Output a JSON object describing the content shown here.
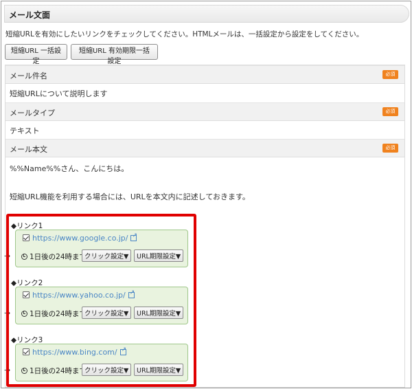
{
  "section": {
    "title": "メール文面",
    "description": "短縮URLを有効にしたいリンクをチェックしてください。HTMLメールは、一括設定から設定をしてください。"
  },
  "buttons": {
    "bulk_short_url": "短縮URL 一括設定",
    "bulk_expiry": "短縮URL 有効期限一括設定"
  },
  "required_label": "必須",
  "fields": {
    "subject": {
      "label": "メール件名",
      "value": "短縮URLについて説明します"
    },
    "type": {
      "label": "メールタイプ",
      "value": "テキスト"
    },
    "body": {
      "label": "メール本文",
      "line1": "%%Name%%さん、こんにちは。",
      "line2": "短縮URL機能を利用する場合には、URLを本文内に記述しておきます。"
    }
  },
  "arrow": "→",
  "links": [
    {
      "label": "◆リンク1",
      "url": "https://www.google.co.jp/",
      "expiry": "1日後の24時まで",
      "click_setting": "クリック設定▼",
      "url_expiry": "URL期限設定▼"
    },
    {
      "label": "◆リンク2",
      "url": "https://www.yahoo.co.jp/",
      "expiry": "1日後の24時まで",
      "click_setting": "クリック設定▼",
      "url_expiry": "URL期限設定▼"
    },
    {
      "label": "◆リンク3",
      "url": "https://www.bing.com/",
      "expiry": "1日後の24時まで",
      "click_setting": "クリック設定▼",
      "url_expiry": "URL期限設定▼"
    }
  ],
  "colors": {
    "required_badge": "#f0821e",
    "link_box_bg": "#e9f3df",
    "link_box_border": "#9fc78a",
    "highlight": "#e00000",
    "url": "#4a86c5"
  }
}
